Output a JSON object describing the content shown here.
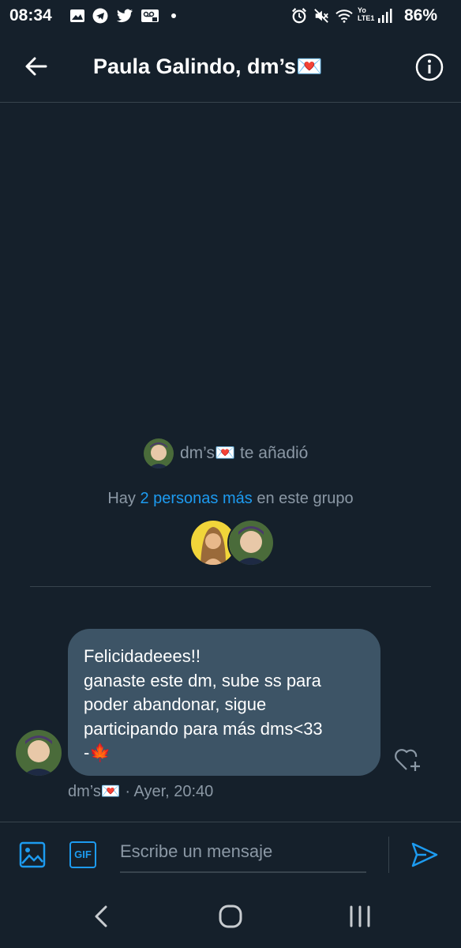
{
  "status_bar": {
    "time": "08:34",
    "battery": "86%",
    "left_icons": [
      "image-icon",
      "telegram-icon",
      "twitter-icon",
      "voicemail-icon",
      "dot-icon"
    ],
    "right_icons": [
      "alarm-icon",
      "mute-icon",
      "wifi-icon",
      "lte-icon",
      "signal-icon"
    ],
    "lte_label": "Yo LTE1"
  },
  "header": {
    "title": "Paula Galindo, dm’s💌",
    "back_icon": "arrow-left-icon",
    "info_icon": "info-icon"
  },
  "conversation": {
    "added_user": "dm’s💌",
    "added_suffix": "te añadió",
    "group_info": {
      "prefix": "Hay ",
      "link": "2 personas más",
      "suffix": " en este grupo"
    },
    "message": {
      "text": "Felicidadeees!!\nganaste este dm, sube ss para\npoder abandonar, sigue\nparticipando para más dms<33\n-🍁",
      "sender": "dm’s💌",
      "separator": "·",
      "time": "Ayer, 20:40",
      "like_icon": "heart-plus-icon"
    }
  },
  "composer": {
    "placeholder": "Escribe un mensaje",
    "gif_label": "GIF",
    "media_icon": "image-icon",
    "send_icon": "send-icon"
  },
  "nav_bar": {
    "back_icon": "nav-back-icon",
    "home_icon": "nav-home-icon",
    "recents_icon": "nav-recents-icon"
  },
  "colors": {
    "background": "#15202b",
    "accent": "#1d9bf0",
    "bubble": "#3d5466",
    "muted": "#8b98a5"
  }
}
